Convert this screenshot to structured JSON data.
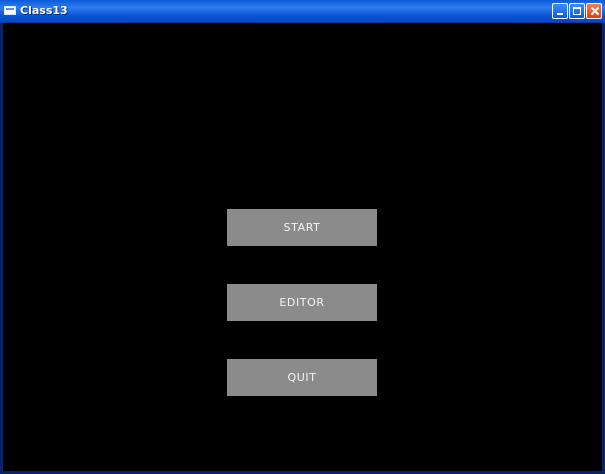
{
  "window": {
    "title": "Class13",
    "icons": {
      "app": "window-icon",
      "minimize": "minimize-icon",
      "maximize": "maximize-icon",
      "close": "close-icon"
    }
  },
  "menu": {
    "buttons": [
      {
        "label": "START"
      },
      {
        "label": "EDITOR"
      },
      {
        "label": "QUIT"
      }
    ]
  },
  "colors": {
    "background": "#000000",
    "button": "#8b8b8b",
    "button_text": "#f4f4f4",
    "titlebar": "#0a56d6"
  }
}
